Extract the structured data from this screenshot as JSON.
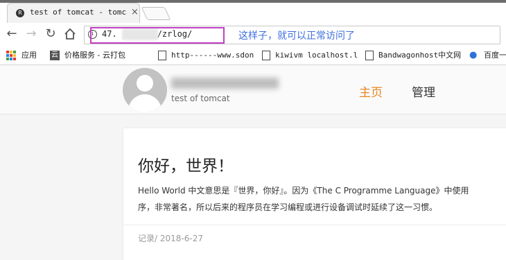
{
  "tab": {
    "title": "test of tomcat - tomca",
    "favicon_letter": "R"
  },
  "toolbar": {
    "url_visible_start": "47.",
    "url_visible_end": "/zrlog/",
    "annotation": "这样子，就可以正常访问了"
  },
  "bookmarks": [
    {
      "label": "应用",
      "icon": "apps-icon"
    },
    {
      "label": "价格服务 - 云打包",
      "icon": "yun-icon",
      "icon_text": "云"
    },
    {
      "label": "http------www.sdon",
      "icon": "doc-icon"
    },
    {
      "label": "kiwivm localhost.l",
      "icon": "doc-icon"
    },
    {
      "label": "Bandwagonhost中文网",
      "icon": "doc-icon"
    },
    {
      "label": "百度一",
      "icon": "paw-icon"
    }
  ],
  "site": {
    "subtitle": "test of tomcat",
    "nav": [
      {
        "label": "主页",
        "active": true
      },
      {
        "label": "管理",
        "active": false
      }
    ]
  },
  "post": {
    "title": "你好，世界！",
    "body_line1": "Hello World 中文意思是『世界，你好』。因为《The C Programme Language》中使用",
    "body_line2": "序，非常著名，所以后来的程序员在学习编程或进行设备调试时延续了这一习惯。",
    "meta": "记录/  2018-6-27"
  },
  "colors": {
    "accent": "#e8861e",
    "annotation": "#3f6fe0",
    "highlight_box": "#c040c0"
  }
}
